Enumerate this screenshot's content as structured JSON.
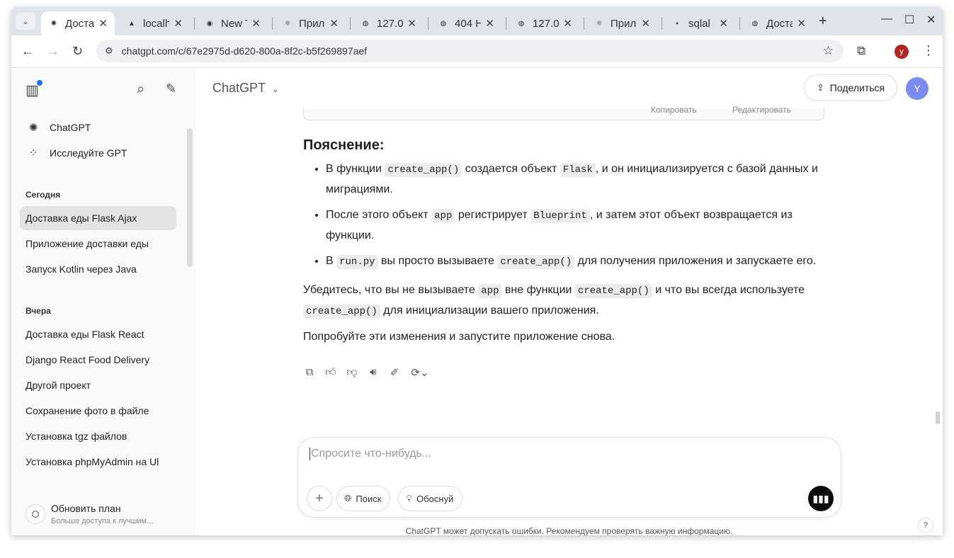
{
  "browser": {
    "tabs": [
      {
        "title": "Доста",
        "icon": "chatgpt-icon",
        "active": true
      },
      {
        "title": "localh",
        "icon": "localhost-icon",
        "active": false
      },
      {
        "title": "New T",
        "icon": "chrome-icon",
        "active": false
      },
      {
        "title": "Прил",
        "icon": "react-icon",
        "active": false
      },
      {
        "title": "127.0",
        "icon": "globe-icon",
        "active": false
      },
      {
        "title": "404 H",
        "icon": "globe-icon",
        "active": false
      },
      {
        "title": "127.0",
        "icon": "globe-icon",
        "active": false
      },
      {
        "title": "Прил",
        "icon": "react-icon",
        "active": false
      },
      {
        "title": "sqlal",
        "icon": "terminal-icon",
        "active": false
      },
      {
        "title": "Доста",
        "icon": "globe-icon",
        "active": false
      }
    ],
    "url": "chatgpt.com/c/67e2975d-d620-800a-8f2c-b5f269897aef",
    "profile_initial": "y"
  },
  "sidebar": {
    "top_items": [
      {
        "label": "ChatGPT",
        "icon": "chatgpt-logo-icon"
      },
      {
        "label": "Исследуйте GPT",
        "icon": "grid-icon"
      }
    ],
    "sections": [
      {
        "title": "Сегодня",
        "items": [
          "Доставка еды Flask Ajax",
          "Приложение доставки еды",
          "Запуск Kotlin через Java"
        ]
      },
      {
        "title": "Вчера",
        "items": [
          "Доставка еды Flask React",
          "Django React Food Delivery",
          "Другой проект",
          "Сохранение фото в файле",
          "Установка tgz файлов",
          "Установка phpMyAdmin на Ul"
        ]
      }
    ],
    "upgrade": {
      "title": "Обновить план",
      "subtitle": "Больше доступа к лучшим..."
    }
  },
  "header": {
    "model": "ChatGPT",
    "share_label": "Поделиться",
    "avatar_initial": "Y"
  },
  "code_toolbar": {
    "copy": "Копировать",
    "edit": "Редактировать"
  },
  "message": {
    "heading": "Пояснение:",
    "bullets": [
      [
        {
          "t": "В функции "
        },
        {
          "c": "create_app()"
        },
        {
          "t": " создается объект "
        },
        {
          "c": "Flask"
        },
        {
          "t": ", и он инициализируется с базой данных и миграциями."
        }
      ],
      [
        {
          "t": "После этого объект "
        },
        {
          "c": "app"
        },
        {
          "t": " регистрирует "
        },
        {
          "c": "Blueprint"
        },
        {
          "t": ", и затем этот объект возвращается из функции."
        }
      ],
      [
        {
          "t": "В "
        },
        {
          "c": "run.py"
        },
        {
          "t": " вы просто вызываете "
        },
        {
          "c": "create_app()"
        },
        {
          "t": " для получения приложения и запускаете его."
        }
      ]
    ],
    "paragraphs": [
      [
        {
          "t": "Убедитесь, что вы не вызываете "
        },
        {
          "c": "app"
        },
        {
          "t": " вне функции "
        },
        {
          "c": "create_app()"
        },
        {
          "t": " и что вы всегда используете "
        },
        {
          "c": "create_app()"
        },
        {
          "t": " для инициализации вашего приложения."
        }
      ],
      [
        {
          "t": "Попробуйте эти изменения и запустите приложение снова."
        }
      ]
    ]
  },
  "composer": {
    "placeholder": "Спросите что-нибудь...",
    "search_label": "Поиск",
    "reason_label": "Обоснуй"
  },
  "disclaimer": "ChatGPT может допускать ошибки. Рекомендуем проверять важную информацию.",
  "help": "?"
}
